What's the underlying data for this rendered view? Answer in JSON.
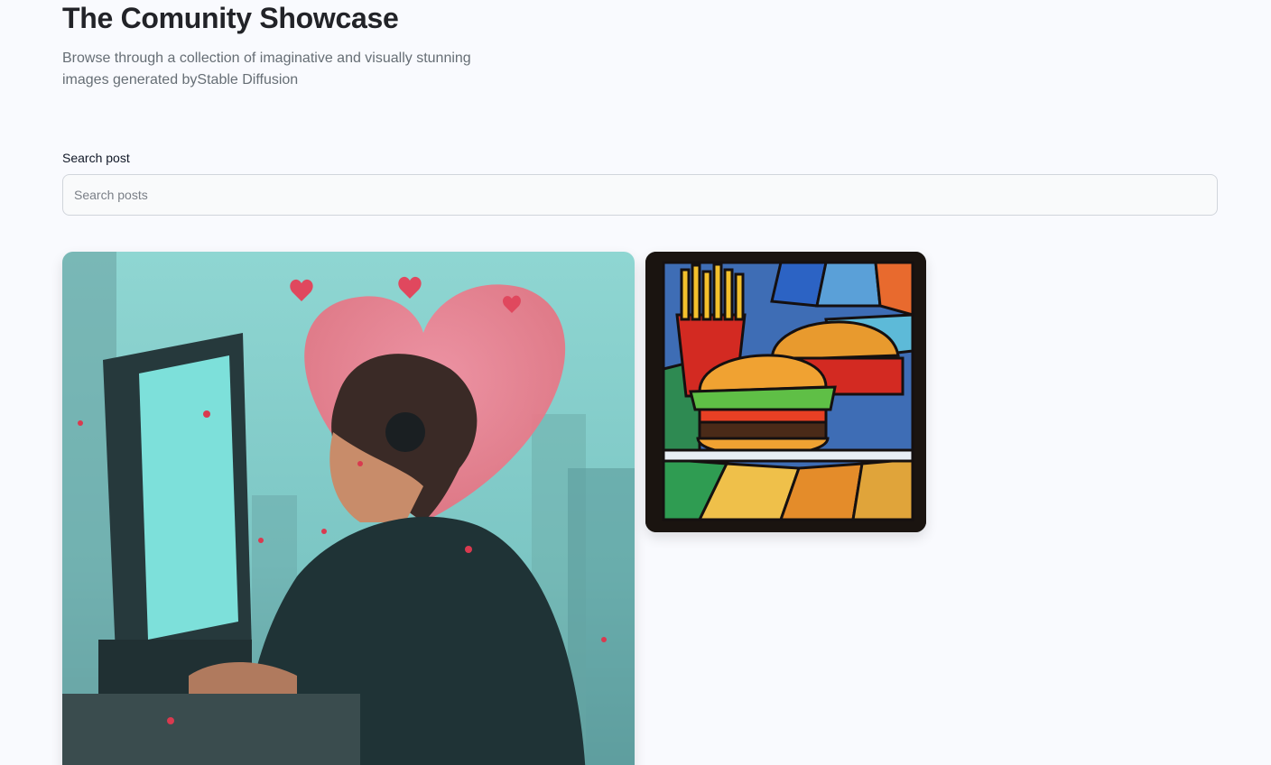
{
  "header": {
    "title": "The Comunity Showcase",
    "subtitle": "Browse through a collection of imaginative and visually stunning images generated byStable Diffusion"
  },
  "search": {
    "label": "Search post",
    "placeholder": "Search posts",
    "value": ""
  },
  "gallery": {
    "posts": [
      {
        "image": "person-at-computer-with-heart-illustration"
      },
      {
        "image": "stained-glass-burger-and-fries"
      }
    ]
  },
  "colors": {
    "background": "#f9fafe",
    "title": "#222328",
    "subtitle": "#666e75",
    "input_border": "#d1d5db"
  }
}
